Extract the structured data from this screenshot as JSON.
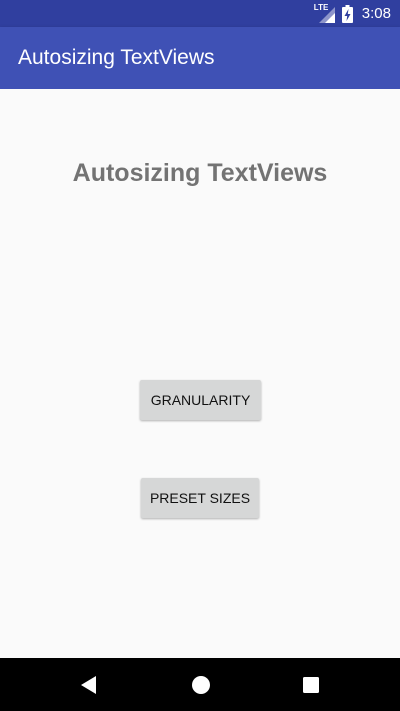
{
  "status_bar": {
    "network_label": "LTE",
    "time": "3:08",
    "icons": [
      "lte-signal-icon",
      "battery-charging-icon"
    ]
  },
  "app_bar": {
    "title": "Autosizing TextViews"
  },
  "main": {
    "headline": "Autosizing TextViews",
    "buttons": [
      {
        "label": "GRANULARITY"
      },
      {
        "label": "PRESET SIZES"
      }
    ]
  },
  "nav_bar": {
    "icons": [
      "back-icon",
      "home-icon",
      "recents-icon"
    ]
  },
  "colors": {
    "status_bar": "#303f9f",
    "app_bar": "#3f51b5",
    "background": "#fafafa",
    "headline": "#737373",
    "button": "#d6d7d7",
    "nav_bar": "#000000"
  }
}
